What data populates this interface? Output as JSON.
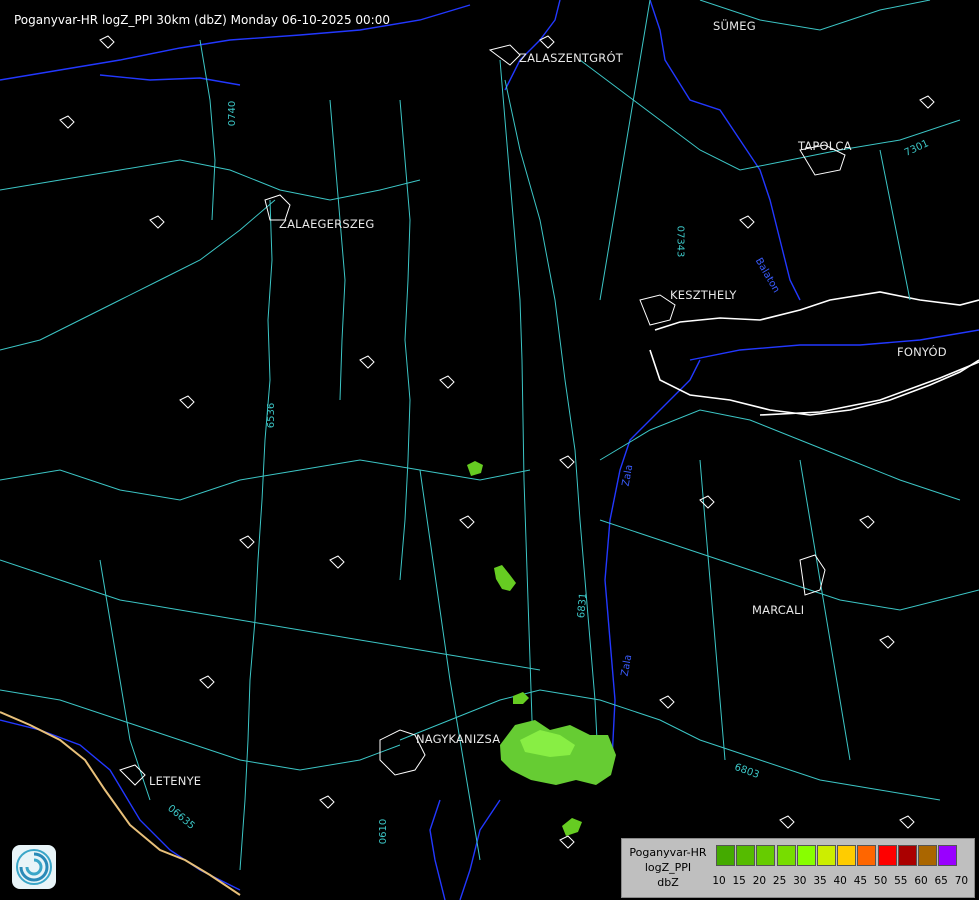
{
  "title": "Poganyvar-HR logZ_PPI 30km (dbZ) Monday 06-10-2025 00:00",
  "cities": [
    {
      "name": "SÜMEG"
    },
    {
      "name": "ZALASZENTGRÓT"
    },
    {
      "name": "TAPOLCA"
    },
    {
      "name": "ZALAEGERSZEG"
    },
    {
      "name": "KESZTHELY"
    },
    {
      "name": "FONYÓD"
    },
    {
      "name": "MARCALI"
    },
    {
      "name": "NAGYKANIZSA"
    },
    {
      "name": "LETENYE"
    }
  ],
  "road_labels": [
    "0740",
    "07343",
    "7301",
    "6536",
    "6831",
    "6803",
    "06635",
    "0610"
  ],
  "river_labels": [
    "Zala",
    "Zala",
    "Balaton"
  ],
  "legend": {
    "title_lines": [
      "Poganyvar-HR",
      "logZ_PPI",
      "dbZ"
    ],
    "ticks": [
      "10",
      "15",
      "20",
      "25",
      "30",
      "35",
      "40",
      "45",
      "50",
      "55",
      "60",
      "65",
      "70"
    ],
    "colors": [
      "#44aa00",
      "#55bb00",
      "#66cc00",
      "#77dd00",
      "#88ff00",
      "#ccee00",
      "#ffcc00",
      "#ff6600",
      "#ff0000",
      "#aa0000",
      "#aa6600",
      "#9900ff",
      "#aaaaff"
    ]
  },
  "palette": {
    "roads": "#3cc6c6",
    "rivers": "#2a3cff",
    "settlements": "#ffffff",
    "echo_light": "#66cc33",
    "echo_strong": "#88ee44",
    "border": "#e8c07a"
  },
  "icons": [
    "radar-logo-icon"
  ]
}
